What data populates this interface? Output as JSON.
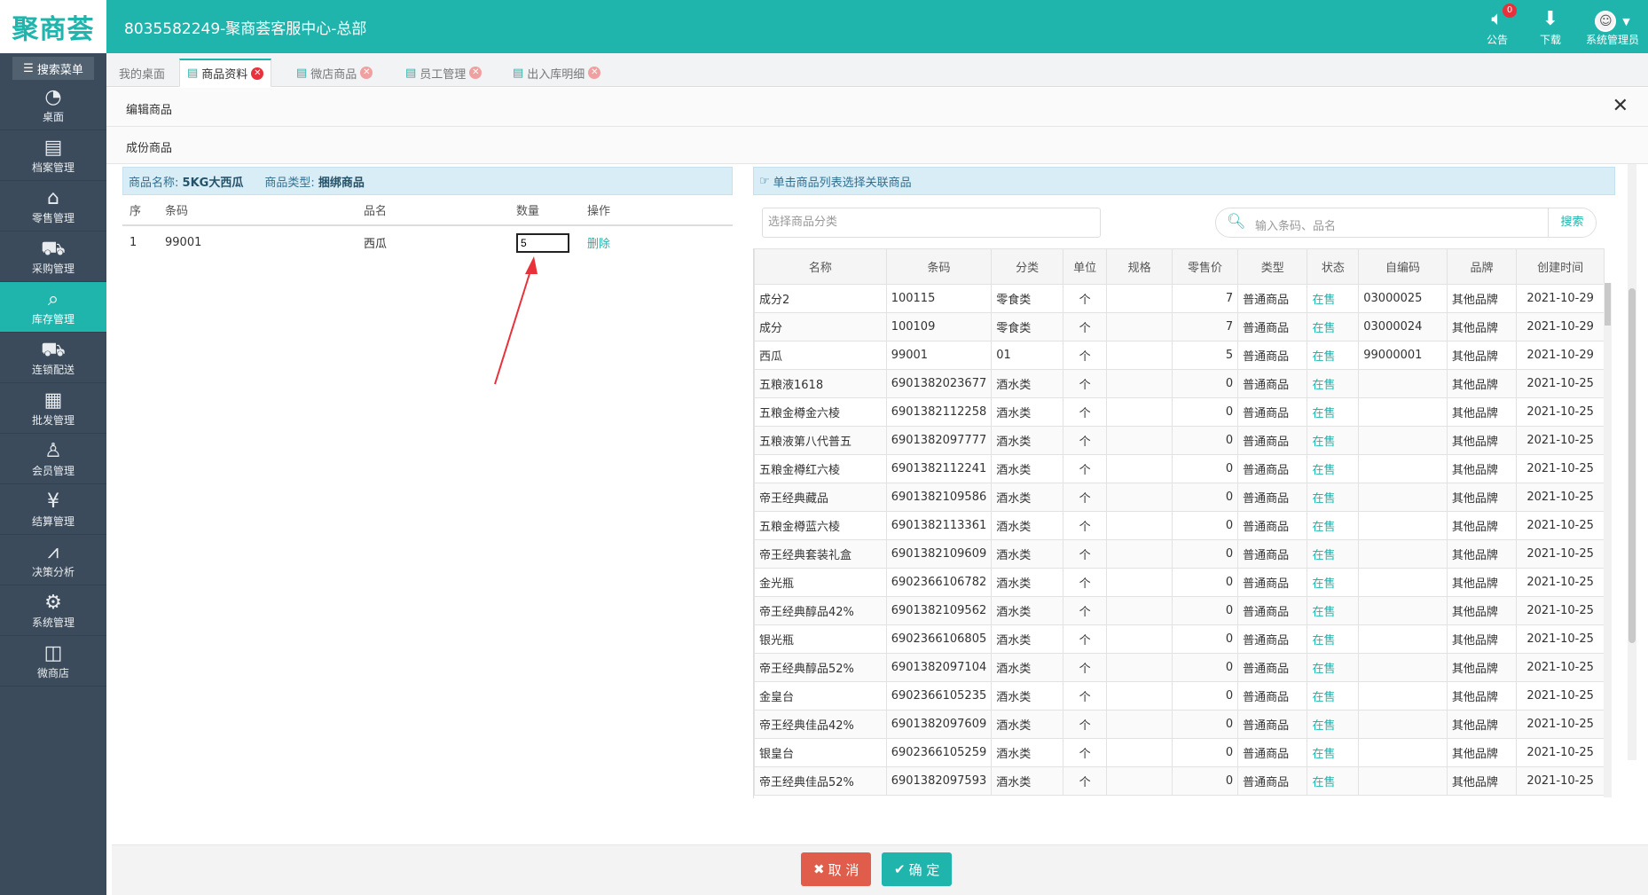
{
  "header": {
    "logo": "聚商荟",
    "title": "8035582249-聚商荟客服中心-总部",
    "notice_label": "公告",
    "notice_count": "0",
    "download_label": "下载",
    "user_label": "系统管理员"
  },
  "sidebar": {
    "search_label": "搜索菜单",
    "items": [
      {
        "label": "桌面",
        "icon": "dashboard-icon"
      },
      {
        "label": "档案管理",
        "icon": "archive-icon"
      },
      {
        "label": "零售管理",
        "icon": "store-icon"
      },
      {
        "label": "采购管理",
        "icon": "cart-icon"
      },
      {
        "label": "库存管理",
        "icon": "inventory-icon"
      },
      {
        "label": "连锁配送",
        "icon": "truck-icon"
      },
      {
        "label": "批发管理",
        "icon": "wholesale-icon"
      },
      {
        "label": "会员管理",
        "icon": "member-icon"
      },
      {
        "label": "结算管理",
        "icon": "yen-icon"
      },
      {
        "label": "决策分析",
        "icon": "chart-icon"
      },
      {
        "label": "系统管理",
        "icon": "gear-icon"
      },
      {
        "label": "微商店",
        "icon": "bag-icon"
      }
    ]
  },
  "tabs": [
    "我的桌面",
    "商品资料",
    "微店商品",
    "员工管理",
    "出入库明细"
  ],
  "dialog": {
    "title": "编辑商品",
    "section": "成份商品",
    "product_name_label": "商品名称:",
    "product_name": "5KG大西瓜",
    "product_type_label": "商品类型:",
    "product_type": "捆绑商品",
    "left_headers": [
      "序",
      "条码",
      "品名",
      "数量",
      "操作"
    ],
    "left_rows": [
      {
        "seq": "1",
        "barcode": "99001",
        "name": "西瓜",
        "qty": "5",
        "action": "删除"
      }
    ],
    "right_hint": "单击商品列表选择关联商品",
    "category_placeholder": "选择商品分类",
    "search_placeholder": "输入条码、品名",
    "search_button": "搜索",
    "grid_headers": [
      "名称",
      "条码",
      "分类",
      "单位",
      "规格",
      "零售价",
      "类型",
      "状态",
      "自编码",
      "品牌",
      "创建时间"
    ],
    "grid_rows": [
      [
        "成分2",
        "100115",
        "零食类",
        "个",
        "",
        "7",
        "普通商品",
        "在售",
        "03000025",
        "其他品牌",
        "2021-10-29"
      ],
      [
        "成分",
        "100109",
        "零食类",
        "个",
        "",
        "7",
        "普通商品",
        "在售",
        "03000024",
        "其他品牌",
        "2021-10-29"
      ],
      [
        "西瓜",
        "99001",
        "01",
        "个",
        "",
        "5",
        "普通商品",
        "在售",
        "99000001",
        "其他品牌",
        "2021-10-29"
      ],
      [
        "五粮液1618",
        "6901382023677",
        "酒水类",
        "个",
        "",
        "0",
        "普通商品",
        "在售",
        "",
        "其他品牌",
        "2021-10-25"
      ],
      [
        "五粮金樽金六棱",
        "6901382112258",
        "酒水类",
        "个",
        "",
        "0",
        "普通商品",
        "在售",
        "",
        "其他品牌",
        "2021-10-25"
      ],
      [
        "五粮液第八代普五",
        "6901382097777",
        "酒水类",
        "个",
        "",
        "0",
        "普通商品",
        "在售",
        "",
        "其他品牌",
        "2021-10-25"
      ],
      [
        "五粮金樽红六棱",
        "6901382112241",
        "酒水类",
        "个",
        "",
        "0",
        "普通商品",
        "在售",
        "",
        "其他品牌",
        "2021-10-25"
      ],
      [
        "帝王经典藏品",
        "6901382109586",
        "酒水类",
        "个",
        "",
        "0",
        "普通商品",
        "在售",
        "",
        "其他品牌",
        "2021-10-25"
      ],
      [
        "五粮金樽蓝六棱",
        "6901382113361",
        "酒水类",
        "个",
        "",
        "0",
        "普通商品",
        "在售",
        "",
        "其他品牌",
        "2021-10-25"
      ],
      [
        "帝王经典套装礼盒",
        "6901382109609",
        "酒水类",
        "个",
        "",
        "0",
        "普通商品",
        "在售",
        "",
        "其他品牌",
        "2021-10-25"
      ],
      [
        "金光瓶",
        "6902366106782",
        "酒水类",
        "个",
        "",
        "0",
        "普通商品",
        "在售",
        "",
        "其他品牌",
        "2021-10-25"
      ],
      [
        "帝王经典醇品42%",
        "6901382109562",
        "酒水类",
        "个",
        "",
        "0",
        "普通商品",
        "在售",
        "",
        "其他品牌",
        "2021-10-25"
      ],
      [
        "银光瓶",
        "6902366106805",
        "酒水类",
        "个",
        "",
        "0",
        "普通商品",
        "在售",
        "",
        "其他品牌",
        "2021-10-25"
      ],
      [
        "帝王经典醇品52%",
        "6901382097104",
        "酒水类",
        "个",
        "",
        "0",
        "普通商品",
        "在售",
        "",
        "其他品牌",
        "2021-10-25"
      ],
      [
        "金皇台",
        "6902366105235",
        "酒水类",
        "个",
        "",
        "0",
        "普通商品",
        "在售",
        "",
        "其他品牌",
        "2021-10-25"
      ],
      [
        "帝王经典佳品42%",
        "6901382097609",
        "酒水类",
        "个",
        "",
        "0",
        "普通商品",
        "在售",
        "",
        "其他品牌",
        "2021-10-25"
      ],
      [
        "银皇台",
        "6902366105259",
        "酒水类",
        "个",
        "",
        "0",
        "普通商品",
        "在售",
        "",
        "其他品牌",
        "2021-10-25"
      ],
      [
        "帝王经典佳品52%",
        "6901382097593",
        "酒水类",
        "个",
        "",
        "0",
        "普通商品",
        "在售",
        "",
        "其他品牌",
        "2021-10-25"
      ]
    ],
    "cancel_label": "取 消",
    "ok_label": "确 定"
  },
  "colors": {
    "accent": "#1fb5ad",
    "sidebar": "#3c4b5c",
    "cancel": "#e05d4b"
  }
}
